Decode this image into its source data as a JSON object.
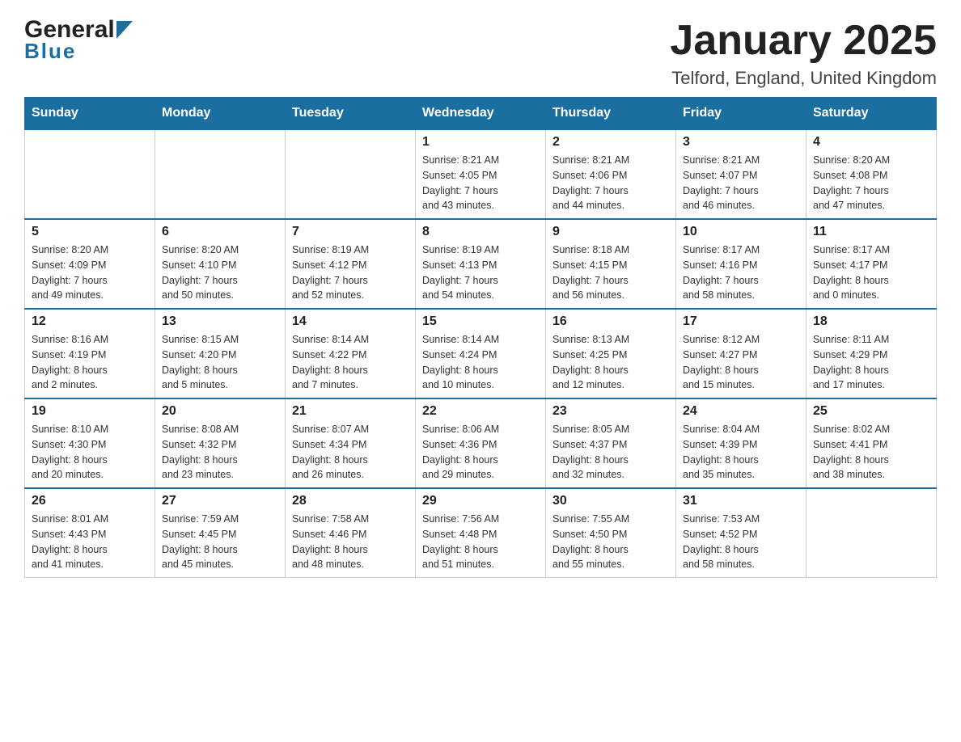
{
  "logo": {
    "name_black": "General",
    "name_blue": "Blue"
  },
  "title": "January 2025",
  "location": "Telford, England, United Kingdom",
  "weekdays": [
    "Sunday",
    "Monday",
    "Tuesday",
    "Wednesday",
    "Thursday",
    "Friday",
    "Saturday"
  ],
  "weeks": [
    [
      {
        "day": "",
        "info": ""
      },
      {
        "day": "",
        "info": ""
      },
      {
        "day": "",
        "info": ""
      },
      {
        "day": "1",
        "info": "Sunrise: 8:21 AM\nSunset: 4:05 PM\nDaylight: 7 hours\nand 43 minutes."
      },
      {
        "day": "2",
        "info": "Sunrise: 8:21 AM\nSunset: 4:06 PM\nDaylight: 7 hours\nand 44 minutes."
      },
      {
        "day": "3",
        "info": "Sunrise: 8:21 AM\nSunset: 4:07 PM\nDaylight: 7 hours\nand 46 minutes."
      },
      {
        "day": "4",
        "info": "Sunrise: 8:20 AM\nSunset: 4:08 PM\nDaylight: 7 hours\nand 47 minutes."
      }
    ],
    [
      {
        "day": "5",
        "info": "Sunrise: 8:20 AM\nSunset: 4:09 PM\nDaylight: 7 hours\nand 49 minutes."
      },
      {
        "day": "6",
        "info": "Sunrise: 8:20 AM\nSunset: 4:10 PM\nDaylight: 7 hours\nand 50 minutes."
      },
      {
        "day": "7",
        "info": "Sunrise: 8:19 AM\nSunset: 4:12 PM\nDaylight: 7 hours\nand 52 minutes."
      },
      {
        "day": "8",
        "info": "Sunrise: 8:19 AM\nSunset: 4:13 PM\nDaylight: 7 hours\nand 54 minutes."
      },
      {
        "day": "9",
        "info": "Sunrise: 8:18 AM\nSunset: 4:15 PM\nDaylight: 7 hours\nand 56 minutes."
      },
      {
        "day": "10",
        "info": "Sunrise: 8:17 AM\nSunset: 4:16 PM\nDaylight: 7 hours\nand 58 minutes."
      },
      {
        "day": "11",
        "info": "Sunrise: 8:17 AM\nSunset: 4:17 PM\nDaylight: 8 hours\nand 0 minutes."
      }
    ],
    [
      {
        "day": "12",
        "info": "Sunrise: 8:16 AM\nSunset: 4:19 PM\nDaylight: 8 hours\nand 2 minutes."
      },
      {
        "day": "13",
        "info": "Sunrise: 8:15 AM\nSunset: 4:20 PM\nDaylight: 8 hours\nand 5 minutes."
      },
      {
        "day": "14",
        "info": "Sunrise: 8:14 AM\nSunset: 4:22 PM\nDaylight: 8 hours\nand 7 minutes."
      },
      {
        "day": "15",
        "info": "Sunrise: 8:14 AM\nSunset: 4:24 PM\nDaylight: 8 hours\nand 10 minutes."
      },
      {
        "day": "16",
        "info": "Sunrise: 8:13 AM\nSunset: 4:25 PM\nDaylight: 8 hours\nand 12 minutes."
      },
      {
        "day": "17",
        "info": "Sunrise: 8:12 AM\nSunset: 4:27 PM\nDaylight: 8 hours\nand 15 minutes."
      },
      {
        "day": "18",
        "info": "Sunrise: 8:11 AM\nSunset: 4:29 PM\nDaylight: 8 hours\nand 17 minutes."
      }
    ],
    [
      {
        "day": "19",
        "info": "Sunrise: 8:10 AM\nSunset: 4:30 PM\nDaylight: 8 hours\nand 20 minutes."
      },
      {
        "day": "20",
        "info": "Sunrise: 8:08 AM\nSunset: 4:32 PM\nDaylight: 8 hours\nand 23 minutes."
      },
      {
        "day": "21",
        "info": "Sunrise: 8:07 AM\nSunset: 4:34 PM\nDaylight: 8 hours\nand 26 minutes."
      },
      {
        "day": "22",
        "info": "Sunrise: 8:06 AM\nSunset: 4:36 PM\nDaylight: 8 hours\nand 29 minutes."
      },
      {
        "day": "23",
        "info": "Sunrise: 8:05 AM\nSunset: 4:37 PM\nDaylight: 8 hours\nand 32 minutes."
      },
      {
        "day": "24",
        "info": "Sunrise: 8:04 AM\nSunset: 4:39 PM\nDaylight: 8 hours\nand 35 minutes."
      },
      {
        "day": "25",
        "info": "Sunrise: 8:02 AM\nSunset: 4:41 PM\nDaylight: 8 hours\nand 38 minutes."
      }
    ],
    [
      {
        "day": "26",
        "info": "Sunrise: 8:01 AM\nSunset: 4:43 PM\nDaylight: 8 hours\nand 41 minutes."
      },
      {
        "day": "27",
        "info": "Sunrise: 7:59 AM\nSunset: 4:45 PM\nDaylight: 8 hours\nand 45 minutes."
      },
      {
        "day": "28",
        "info": "Sunrise: 7:58 AM\nSunset: 4:46 PM\nDaylight: 8 hours\nand 48 minutes."
      },
      {
        "day": "29",
        "info": "Sunrise: 7:56 AM\nSunset: 4:48 PM\nDaylight: 8 hours\nand 51 minutes."
      },
      {
        "day": "30",
        "info": "Sunrise: 7:55 AM\nSunset: 4:50 PM\nDaylight: 8 hours\nand 55 minutes."
      },
      {
        "day": "31",
        "info": "Sunrise: 7:53 AM\nSunset: 4:52 PM\nDaylight: 8 hours\nand 58 minutes."
      },
      {
        "day": "",
        "info": ""
      }
    ]
  ]
}
